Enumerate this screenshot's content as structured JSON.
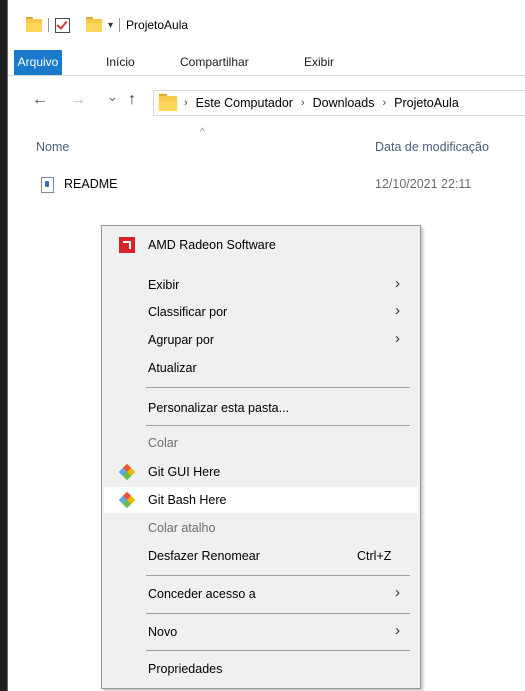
{
  "window": {
    "title": "ProjetoAula",
    "qat_dropdown": "▾"
  },
  "ribbon": {
    "tabs": [
      {
        "label": "Arquivo"
      },
      {
        "label": "Início"
      },
      {
        "label": "Compartilhar"
      },
      {
        "label": "Exibir"
      }
    ]
  },
  "nav": {
    "back": "←",
    "forward": "→",
    "recent": "⌄",
    "up": "↑",
    "breadcrumb": [
      "Este Computador",
      "Downloads",
      "ProjetoAula"
    ],
    "separator": "›"
  },
  "columns": {
    "name": "Nome",
    "date_modified": "Data de modificação",
    "sort_indicator": "^"
  },
  "files": [
    {
      "name": "README",
      "date": "12/10/2021 22:11",
      "icon": "text-file-icon"
    }
  ],
  "context_menu": {
    "items": [
      {
        "label": "AMD Radeon Software",
        "icon": "amd-radeon-icon"
      },
      {
        "label": "Exibir",
        "submenu": "›"
      },
      {
        "label": "Classificar por",
        "submenu": "›"
      },
      {
        "label": "Agrupar por",
        "submenu": "›"
      },
      {
        "label": "Atualizar"
      },
      {
        "label": "Personalizar esta pasta..."
      },
      {
        "label": "Colar",
        "disabled": true
      },
      {
        "label": "Git GUI Here",
        "icon": "git-icon"
      },
      {
        "label": "Git Bash Here",
        "icon": "git-icon",
        "highlighted": true
      },
      {
        "label": "Colar atalho",
        "disabled": true
      },
      {
        "label": "Desfazer Renomear",
        "shortcut": "Ctrl+Z"
      },
      {
        "label": "Conceder acesso a",
        "submenu": "›"
      },
      {
        "label": "Novo",
        "submenu": "›"
      },
      {
        "label": "Propriedades"
      }
    ]
  },
  "colors": {
    "accent": "#1979ca",
    "folder": "#f7c948",
    "menu_bg": "#f0f0f0",
    "header_text": "#4c607a"
  }
}
